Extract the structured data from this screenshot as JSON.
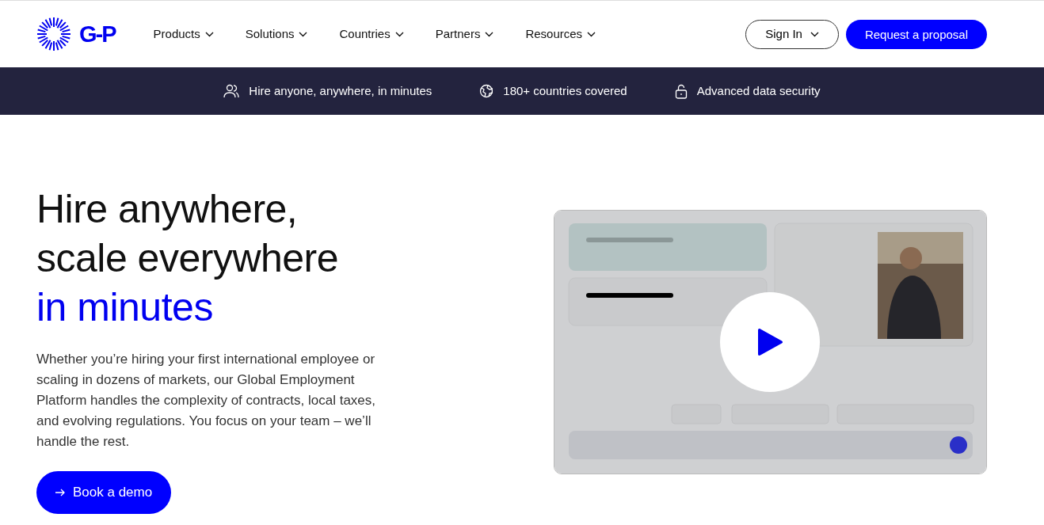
{
  "header": {
    "logo": "G-P",
    "nav": [
      {
        "label": "Products"
      },
      {
        "label": "Solutions"
      },
      {
        "label": "Countries"
      },
      {
        "label": "Partners"
      },
      {
        "label": "Resources"
      }
    ],
    "sign_in": "Sign In",
    "cta": "Request a proposal"
  },
  "features": [
    {
      "kind": "people",
      "label": "Hire anyone, anywhere, in minutes"
    },
    {
      "kind": "globe",
      "label": "180+ countries covered"
    },
    {
      "kind": "lock",
      "label": "Advanced data security"
    }
  ],
  "hero": {
    "title_lines": [
      "Hire anywhere,",
      "scale everywhere"
    ],
    "title_accent": "in minutes",
    "body": "Whether you’re hiring your first international employee or scaling in dozens of markets, our Global Employment Platform handles the complexity of contracts, local taxes, and evolving regulations. You focus on your team – we’ll handle the rest.",
    "button": "Book a demo"
  }
}
